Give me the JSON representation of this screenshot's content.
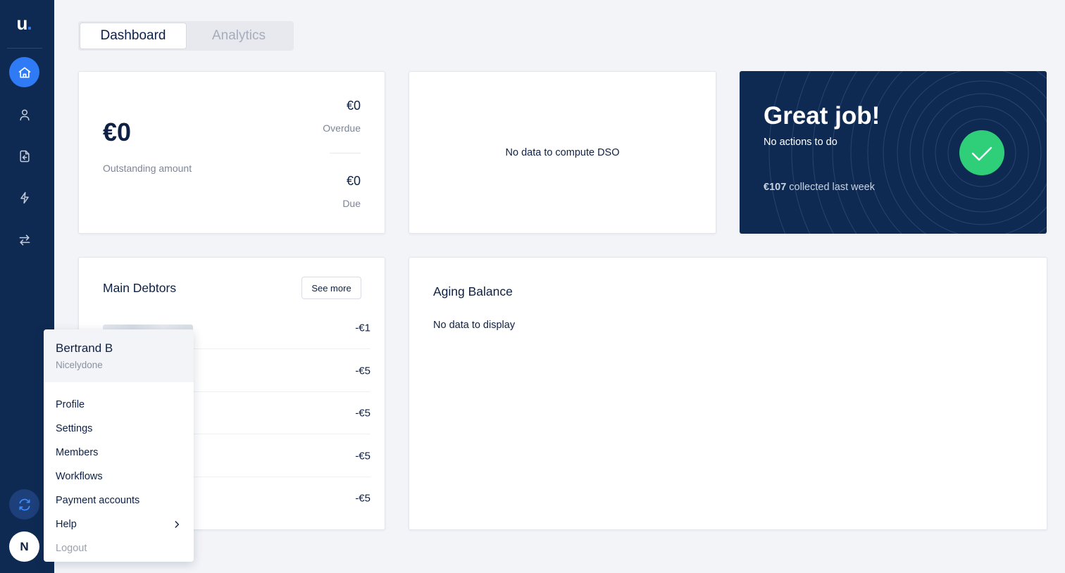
{
  "app": {
    "logo_text": "u",
    "logo_dot": "."
  },
  "sidebar": {
    "items": [
      {
        "name": "home",
        "icon": "home-icon",
        "active": true
      },
      {
        "name": "customers",
        "icon": "user-icon",
        "active": false
      },
      {
        "name": "invoices",
        "icon": "file-import-icon",
        "active": false
      },
      {
        "name": "automations",
        "icon": "bolt-icon",
        "active": false
      },
      {
        "name": "transactions",
        "icon": "arrows-exchange-icon",
        "active": false
      }
    ],
    "sync_icon": "sync-icon",
    "avatar_initial": "N"
  },
  "tabs": [
    {
      "label": "Dashboard",
      "active": true
    },
    {
      "label": "Analytics",
      "active": false
    }
  ],
  "outstanding": {
    "amount": "€0",
    "label": "Outstanding amount",
    "overdue_amount": "€0",
    "overdue_label": "Overdue",
    "due_amount": "€0",
    "due_label": "Due"
  },
  "dso": {
    "empty_text": "No data to compute DSO"
  },
  "great_job": {
    "title": "Great job!",
    "subtitle": "No actions to do",
    "collected_amount": "€107",
    "collected_text": " collected last week",
    "colors": {
      "background": "#0f2a52",
      "check": "#2fcf7a"
    }
  },
  "main_debtors": {
    "title": "Main Debtors",
    "see_more_label": "See more",
    "rows": [
      {
        "amount": "-€1"
      },
      {
        "amount": "-€5"
      },
      {
        "amount": "-€5"
      },
      {
        "amount": "-€5"
      },
      {
        "amount": "-€5"
      }
    ]
  },
  "aging_balance": {
    "title": "Aging Balance",
    "empty_text": "No data to display"
  },
  "user_menu": {
    "name": "Bertrand B",
    "organization": "Nicelydone",
    "items": [
      {
        "label": "Profile"
      },
      {
        "label": "Settings"
      },
      {
        "label": "Members"
      },
      {
        "label": "Workflows"
      },
      {
        "label": "Payment accounts"
      },
      {
        "label": "Help",
        "has_submenu": true
      },
      {
        "label": "Logout",
        "muted": true
      }
    ]
  },
  "colors": {
    "sidebar": "#0f2a52",
    "accent": "#2f7bf5",
    "page_background": "#f3f4f8",
    "text": "#0e2043"
  }
}
